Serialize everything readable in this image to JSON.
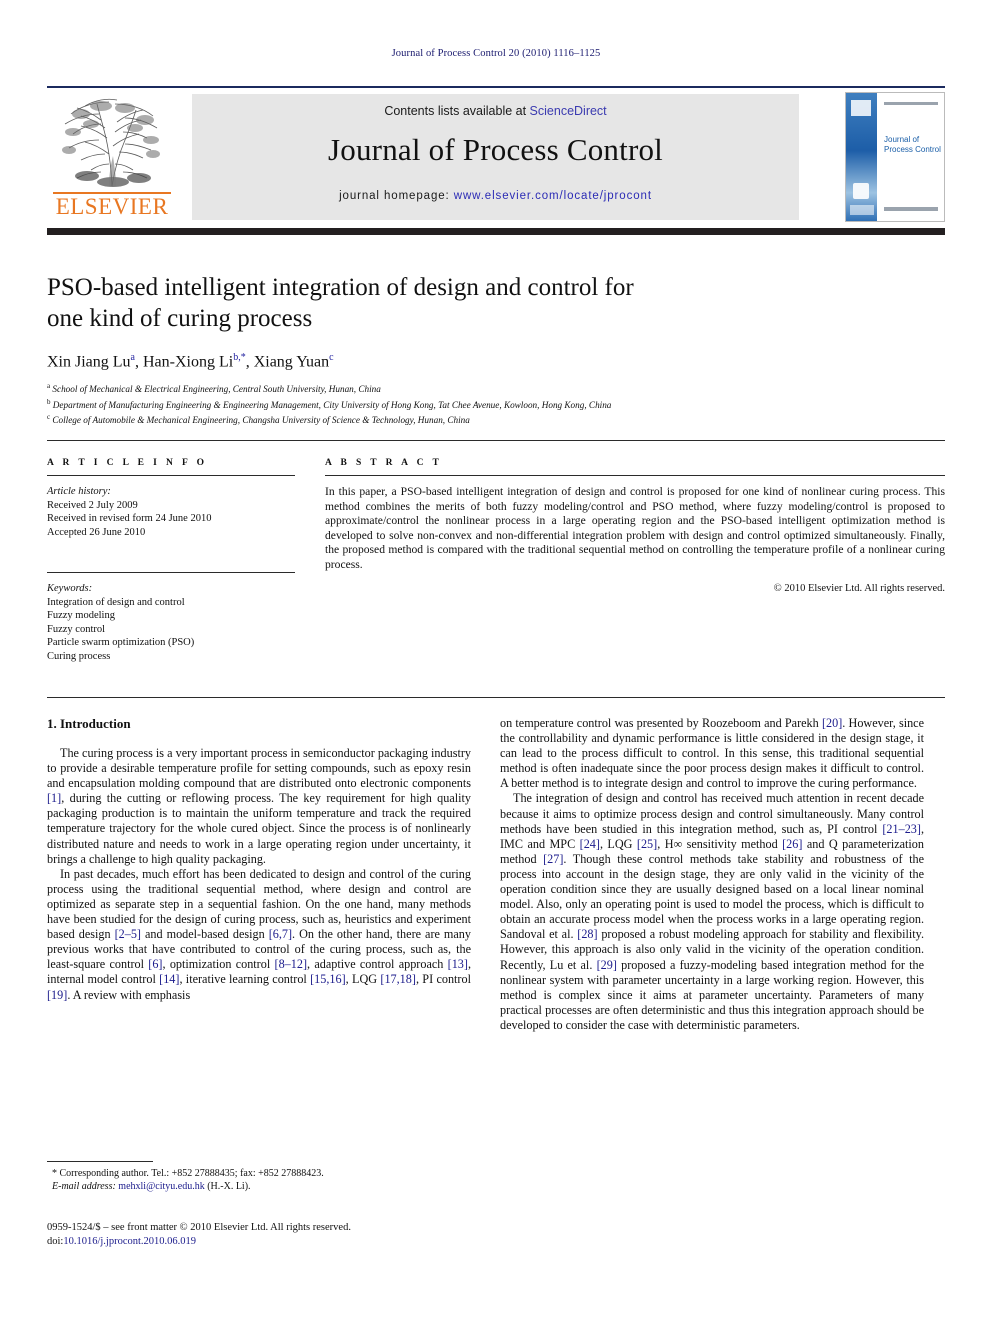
{
  "running_head": "Journal of Process Control 20 (2010) 1116–1125",
  "masthead": {
    "contents_prefix": "Contents lists available at ",
    "sciencedirect": "ScienceDirect",
    "journal_name": "Journal of Process Control",
    "homepage_prefix": "journal homepage: ",
    "homepage_url": "www.elsevier.com/locate/jprocont",
    "publisher": "ELSEVIER",
    "cover_title_line1": "Journal of",
    "cover_title_line2": "Process Control",
    "accent_orange": "#e87722",
    "link_blue": "#2b2bb5",
    "rule_navy": "#1b2a5e",
    "rule_dark": "#231f20"
  },
  "title": {
    "line1": "PSO-based intelligent integration of design and control for",
    "line2": "one kind of curing process"
  },
  "authors": {
    "list": [
      {
        "name": "Xin Jiang Lu",
        "sup": "a"
      },
      {
        "name": "Han-Xiong Li",
        "sup": "b,*"
      },
      {
        "name": "Xiang Yuan",
        "sup": "c"
      }
    ],
    "affiliations": [
      {
        "sup": "a",
        "text": "School of Mechanical & Electrical Engineering, Central South University, Hunan, China"
      },
      {
        "sup": "b",
        "text": "Department of Manufacturing Engineering & Engineering Management, City University of Hong Kong, Tat Chee Avenue, Kowloon, Hong Kong, China"
      },
      {
        "sup": "c",
        "text": "College of Automobile & Mechanical Engineering, Changsha University of Science & Technology, Hunan, China"
      }
    ]
  },
  "article_info": {
    "heading": "A R T I C L E    I N F O",
    "history_label": "Article history:",
    "history": [
      "Received 2 July 2009",
      "Received in revised form 24 June 2010",
      "Accepted 26 June 2010"
    ],
    "keywords_label": "Keywords:",
    "keywords": [
      "Integration of design and control",
      "Fuzzy modeling",
      "Fuzzy control",
      "Particle swarm optimization (PSO)",
      "Curing process"
    ]
  },
  "abstract": {
    "heading": "A B S T R A C T",
    "text": "In this paper, a PSO-based intelligent integration of design and control is proposed for one kind of nonlinear curing process. This method combines the merits of both fuzzy modeling/control and PSO method, where fuzzy modeling/control is proposed to approximate/control the nonlinear process in a large operating region and the PSO-based intelligent optimization method is developed to solve non-convex and non-differential integration problem with design and control optimized simultaneously. Finally, the proposed method is compared with the traditional sequential method on controlling the temperature profile of a nonlinear curing process.",
    "copyright": "© 2010 Elsevier Ltd. All rights reserved."
  },
  "body": {
    "section_heading": "1. Introduction",
    "left_paragraphs": [
      "The curing process is a very important process in semiconductor packaging industry to provide a desirable temperature profile for setting compounds, such as epoxy resin and encapsulation molding compound that are distributed onto electronic components [1], during the cutting or reflowing process. The key requirement for high quality packaging production is to maintain the uniform temperature and track the required temperature trajectory for the whole cured object. Since the process is of nonlinearly distributed nature and needs to work in a large operating region under uncertainty, it brings a challenge to high quality packaging.",
      "In past decades, much effort has been dedicated to design and control of the curing process using the traditional sequential method, where design and control are optimized as separate step in a sequential fashion. On the one hand, many methods have been studied for the design of curing process, such as, heuristics and experiment based design [2–5] and model-based design [6,7]. On the other hand, there are many previous works that have contributed to control of the curing process, such as, the least-square control [6], optimization control [8–12], adaptive control approach [13], internal model control [14], iterative learning control [15,16], LQG [17,18], PI control [19]. A review with emphasis"
    ],
    "right_paragraphs": [
      "on temperature control was presented by Roozeboom and Parekh [20]. However, since the controllability and dynamic performance is little considered in the design stage, it can lead to the process difficult to control. In this sense, this traditional sequential method is often inadequate since the poor process design makes it difficult to control. A better method is to integrate design and control to improve the curing performance.",
      "The integration of design and control has received much attention in recent decade because it aims to optimize process design and control simultaneously. Many control methods have been studied in this integration method, such as, PI control [21–23], IMC and MPC [24], LQG [25], H∞ sensitivity method [26] and Q parameterization method [27]. Though these control methods take stability and robustness of the process into account in the design stage, they are only valid in the vicinity of the operation condition since they are usually designed based on a local linear nominal model. Also, only an operating point is used to model the process, which is difficult to obtain an accurate process model when the process works in a large operating region. Sandoval et al. [28] proposed a robust modeling approach for stability and flexibility. However, this approach is also only valid in the vicinity of the operation condition. Recently, Lu et al. [29] proposed a fuzzy-modeling based integration method for the nonlinear system with parameter uncertainty in a large working region. However, this method is complex since it aims at parameter uncertainty. Parameters of many practical processes are often deterministic and thus this integration approach should be developed to consider the case with deterministic parameters."
    ]
  },
  "footnotes": {
    "corresponding": "* Corresponding author. Tel.: +852 27888435; fax: +852 27888423.",
    "email_label": "E-mail address:",
    "email": "mehxli@cityu.edu.hk",
    "email_owner": "(H.-X. Li)."
  },
  "imprint": {
    "line1": "0959-1524/$ – see front matter © 2010 Elsevier Ltd. All rights reserved.",
    "doi_label": "doi:",
    "doi": "10.1016/j.jprocont.2010.06.019"
  }
}
